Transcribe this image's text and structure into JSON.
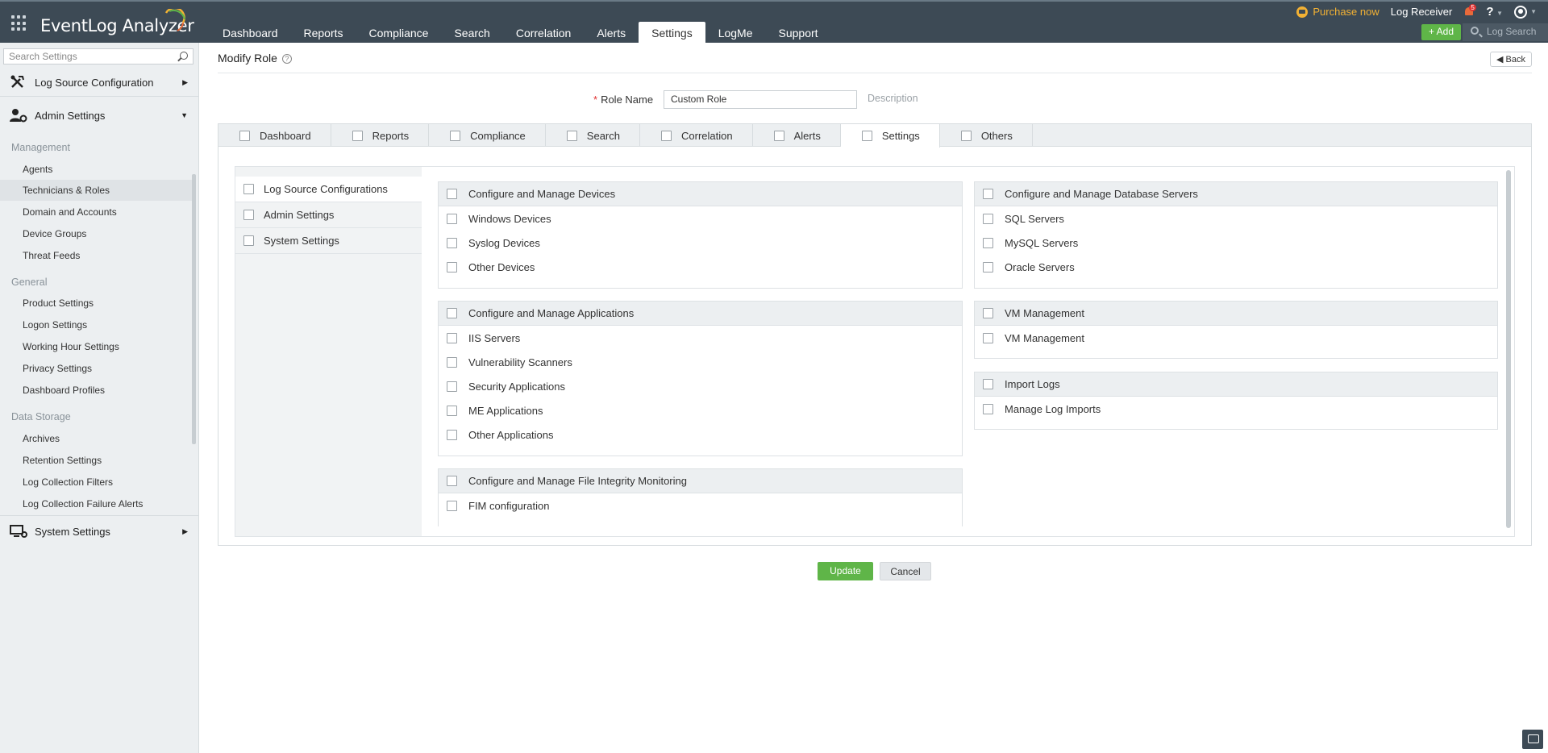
{
  "app": {
    "title": "EventLog Analyzer"
  },
  "nav": {
    "tabs": [
      "Dashboard",
      "Reports",
      "Compliance",
      "Search",
      "Correlation",
      "Alerts",
      "Settings",
      "LogMe",
      "Support"
    ],
    "active": "Settings"
  },
  "top_right": {
    "purchase": "Purchase now",
    "log_receiver": "Log Receiver",
    "notification_count": "5",
    "help": "?",
    "add": "Add",
    "log_search": "Log Search"
  },
  "sidebar": {
    "search_placeholder": "Search Settings",
    "log_source_configuration": "Log Source Configuration",
    "admin_settings": "Admin Settings",
    "system_settings": "System Settings",
    "groups": {
      "management": "Management",
      "general": "General",
      "data_storage": "Data Storage"
    },
    "management_items": [
      "Agents",
      "Technicians & Roles",
      "Domain and Accounts",
      "Device Groups",
      "Threat Feeds"
    ],
    "general_items": [
      "Product Settings",
      "Logon Settings",
      "Working Hour Settings",
      "Privacy Settings",
      "Dashboard Profiles"
    ],
    "storage_items": [
      "Archives",
      "Retention Settings",
      "Log Collection Filters",
      "Log Collection Failure Alerts"
    ],
    "active_item": "Technicians & Roles"
  },
  "page": {
    "title": "Modify Role",
    "help": "?",
    "back": "Back",
    "role_name_label": "Role Name",
    "required_mark": "*",
    "role_name_value": "Custom Role",
    "description_link": "Description",
    "update": "Update",
    "cancel": "Cancel"
  },
  "perm_tabs": [
    "Dashboard",
    "Reports",
    "Compliance",
    "Search",
    "Correlation",
    "Alerts",
    "Settings",
    "Others"
  ],
  "active_perm_tab": "Settings",
  "left_categories": [
    "Log Source Configurations",
    "Admin Settings",
    "System Settings"
  ],
  "active_category": "Log Source Configurations",
  "groups": {
    "devices": {
      "title": "Configure and Manage Devices",
      "items": [
        "Windows Devices",
        "Syslog Devices",
        "Other Devices"
      ]
    },
    "applications": {
      "title": "Configure and Manage Applications",
      "items": [
        "IIS Servers",
        "Vulnerability Scanners",
        "Security Applications",
        "ME Applications",
        "Other Applications"
      ]
    },
    "fim": {
      "title": "Configure and Manage File Integrity Monitoring",
      "items": [
        "FIM configuration"
      ]
    },
    "db_servers": {
      "title": "Configure and Manage Database Servers",
      "items": [
        "SQL Servers",
        "MySQL Servers",
        "Oracle Servers"
      ]
    },
    "vm": {
      "title": "VM Management",
      "items": [
        "VM Management"
      ]
    },
    "import_logs": {
      "title": "Import Logs",
      "items": [
        "Manage Log Imports"
      ]
    }
  },
  "colors": {
    "topbar": "#3d4a55",
    "accent_green": "#5fb548",
    "purchase_gold": "#f2b134",
    "sidebar_bg": "#eceff1"
  }
}
